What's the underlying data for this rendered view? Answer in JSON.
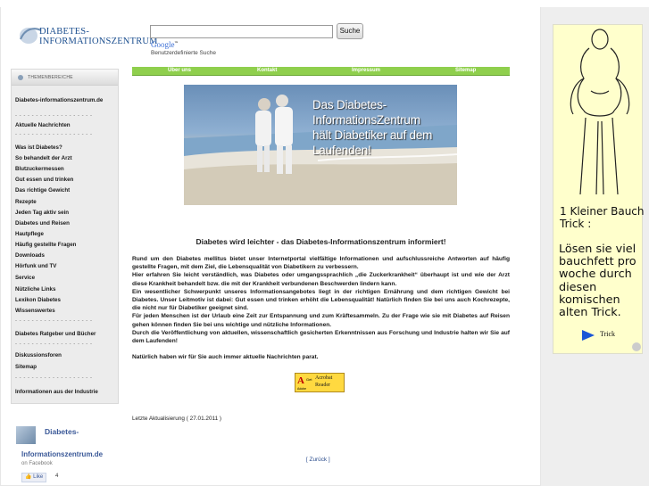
{
  "logo": {
    "line1": "DIABETES-",
    "line2": "INFORMATIONSZENTRUM"
  },
  "search": {
    "value": "",
    "button_label": "Suche",
    "google_label": "Google",
    "google_sub": "Benutzerdefinierte Suche"
  },
  "sidebar": {
    "header": "THEMENBEREICHE",
    "items": [
      "Diabetes-informationszentrum.de",
      "- - - - - - - - - - - - - - - - - - -",
      "Aktuelle Nachrichten",
      "- - - - - - - - - - - - - - - - - - -",
      "Was ist Diabetes?",
      "So behandelt der Arzt",
      "Blutzuckermessen",
      "Gut essen und trinken",
      "Das richtige Gewicht",
      "Rezepte",
      "Jeden Tag aktiv sein",
      "Diabetes und Reisen",
      "Hautpflege",
      "Häufig gestellte Fragen",
      "Downloads",
      "Hörfunk und TV",
      "Service",
      "Nützliche Links",
      "Lexikon Diabetes",
      "Wissenswertes",
      "- - - - - - - - - - - - - - - - - - -",
      "Diabetes Ratgeber und Bücher",
      "- - - - - - - - - - - - - - - - - - -",
      "Diskussionsforen",
      "Sitemap",
      "- - - - - - - - - - - - - - - - - - -",
      "Informationen aus der Industrie"
    ]
  },
  "facebook": {
    "name_line1": "Diabetes-",
    "name_line2": "Informationszentrum.de",
    "on_facebook": "on Facebook",
    "like_label": "Like",
    "like_count": "4"
  },
  "topnav": {
    "items": [
      "Über uns",
      "Kontakt",
      "Impressum",
      "Sitemap"
    ]
  },
  "hero": {
    "caption": [
      "Das Diabetes-",
      "InformationsZentrum",
      "hält Diabetiker auf dem",
      "Laufenden!"
    ]
  },
  "main": {
    "title": "Diabetes wird leichter - das Diabetes-Informationszentrum informiert!",
    "paragraphs": [
      "Rund um den Diabetes mellitus bietet unser Internetportal vielfältige Informationen und aufschlussreiche Antworten auf häufig gestellte Fragen, mit dem Ziel, die Lebensqualität von Diabetikern zu verbessern.",
      "Hier erfahren Sie leicht verständlich, was Diabetes oder umgangssprachlich „die Zuckerkrankheit“ überhaupt ist und wie der Arzt diese Krankheit behandelt bzw. die mit der Krankheit verbundenen Beschwerden lindern kann.",
      "Ein wesentlicher Schwerpunkt unseres Informationsangebotes liegt in der richtigen Ernährung und dem richtigen Gewicht bei Diabetes. Unser Leitmotiv ist dabei: Gut essen und trinken erhöht die Lebensqualität! Natürlich finden Sie bei uns auch Kochrezepte, die nicht nur für Diabetiker geeignet sind.",
      "Für jeden Menschen ist der Urlaub eine Zeit zur Entspannung und zum Kräftesammeln. Zu der Frage wie sie mit Diabetes auf Reisen gehen können finden Sie bei uns wichtige und nützliche Informationen.",
      "Durch die Veröffentlichung von aktuellen, wissenschaftlich gesicherten Erkenntnissen aus Forschung und Industrie halten wir Sie auf dem Laufenden!",
      "Natürlich haben wir für Sie auch immer aktuelle Nachrichten parat."
    ],
    "acrobat": {
      "get": "Get",
      "adobe": "Adobe",
      "line1": "Acrobat",
      "line2": "Reader"
    },
    "updated": "Letzte Aktualisierung ( 27.01.2011 )",
    "back_link": "[ Zurück ]"
  },
  "ad": {
    "headline": [
      "1 Kleiner Bauch",
      "Trick :"
    ],
    "body": [
      "Lösen sie viel",
      "bauchfett pro",
      "woche durch",
      "diesen",
      "komischen",
      "alten Trick."
    ],
    "cta": "Trick"
  }
}
